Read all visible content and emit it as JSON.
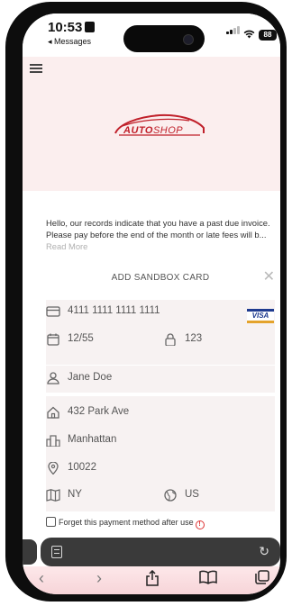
{
  "status_bar": {
    "time": "10:53",
    "back_label": "◂ Messages",
    "battery": "88"
  },
  "invoice": {
    "message": "Hello, our records indicate that you have a past due invoice. Please pay before the end of the month or late fees will b...",
    "read_more": "Read More"
  },
  "card_form": {
    "title": "ADD SANDBOX CARD",
    "card_number": "4111 1111 1111 1111",
    "card_brand": "VISA",
    "expiry": "12/55",
    "cvv": "123",
    "name": "Jane Doe",
    "street": "432 Park Ave",
    "city": "Manhattan",
    "zip": "10022",
    "state": "NY",
    "country": "US",
    "forget_label": "Forget this payment method after use"
  },
  "logo": {
    "word1": "AUTO",
    "word2": "SHOP"
  },
  "colors": {
    "hero_bg": "#fbeeee",
    "brand_red": "#c0202a",
    "panel_bg": "#f7f2f2",
    "visa_blue": "#1f3b8f"
  }
}
